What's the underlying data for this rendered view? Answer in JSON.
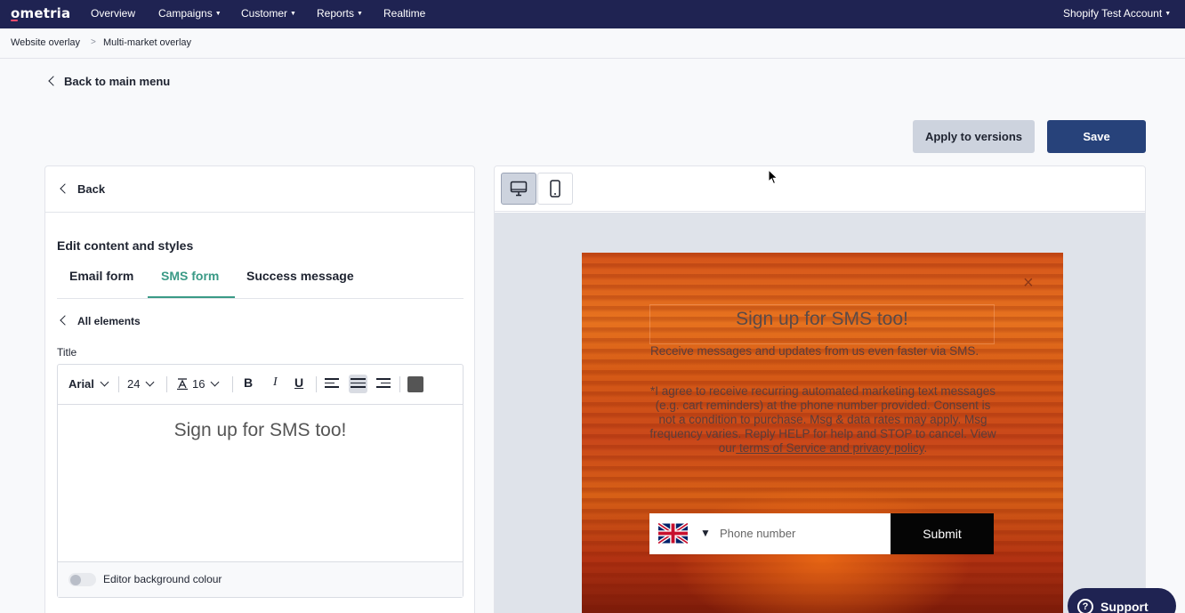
{
  "nav": {
    "logo": "ometria",
    "items": [
      "Overview",
      "Campaigns",
      "Customer",
      "Reports",
      "Realtime"
    ],
    "account": "Shopify Test Account"
  },
  "breadcrumb": [
    "Website overlay",
    "Multi-market overlay"
  ],
  "breadcrumb_sep": ">",
  "back_main": "Back to main menu",
  "actions": {
    "apply": "Apply to versions",
    "save": "Save"
  },
  "panel": {
    "back": "Back",
    "heading": "Edit content and styles",
    "tabs": [
      "Email form",
      "SMS form",
      "Success message"
    ],
    "active_tab": "SMS form",
    "all_elements": "All elements",
    "field_label": "Title",
    "toolbar": {
      "font": "Arial",
      "size": "24",
      "line_height": "16"
    },
    "editor_text": "Sign up for SMS too!",
    "bg_toggle_label": "Editor background colour",
    "bg_toggle_on": false
  },
  "overlay": {
    "close": "×",
    "title": "Sign up for SMS too!",
    "description": "Receive messages and updates from us even faster via SMS.",
    "consent_text": "*I agree to receive recurring automated marketing text messages (e.g. cart reminders) at the phone number provided. Consent is not a condition to purchase. Msg & data rates may apply. Msg frequency varies. Reply HELP for help and STOP to cancel. View our",
    "consent_link": " terms of Service and privacy policy",
    "consent_end": ".",
    "dropdown_caret": "▼",
    "phone_placeholder": "Phone number",
    "submit": "Submit"
  },
  "support": {
    "label": "Support",
    "icon": "?"
  },
  "colors": {
    "nav_bg": "#1f2352",
    "save_bg": "#27427a",
    "active_tab": "#3a9a86"
  }
}
